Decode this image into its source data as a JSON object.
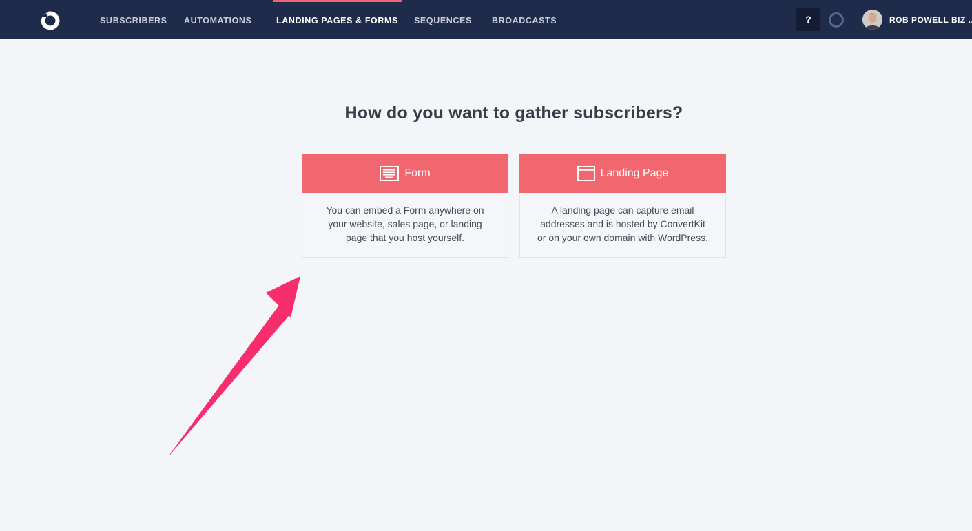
{
  "header": {
    "nav": [
      {
        "label": "SUBSCRIBERS"
      },
      {
        "label": "AUTOMATIONS"
      },
      {
        "label": "LANDING PAGES & FORMS"
      },
      {
        "label": "SEQUENCES"
      },
      {
        "label": "BROADCASTS"
      }
    ],
    "active_nav": "LANDING PAGES & FORMS",
    "help_label": "?",
    "user_name": "ROB POWELL BIZ ..."
  },
  "main": {
    "title": "How do you want to gather subscribers?",
    "options": [
      {
        "title": "Form",
        "icon": "form-icon",
        "lines": [
          "You can embed a Form anywhere on",
          "your website, sales page, or landing",
          "page that you host yourself."
        ]
      },
      {
        "title": "Landing Page",
        "icon": "landing-page-icon",
        "lines": [
          "A landing page can capture email",
          "addresses and is hosted by ConvertKit",
          "or on your own domain with WordPress."
        ]
      }
    ]
  },
  "colors": {
    "nav_bg": "#1f2b4a",
    "accent": "#f2676f",
    "page_bg": "#f3f5f9",
    "annotation_arrow": "#f72e6e"
  }
}
